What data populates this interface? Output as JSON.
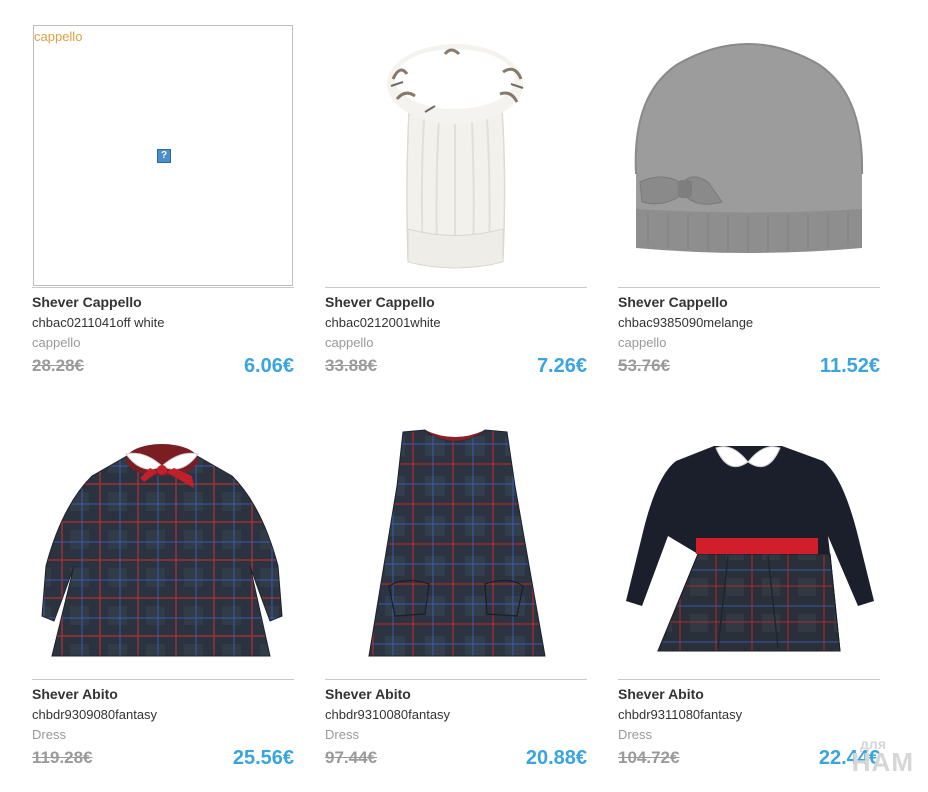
{
  "products": [
    {
      "brand": "Shever Cappello",
      "sku": "chbac0211041off white",
      "category": "cappello",
      "old_price": "28.28€",
      "new_price": "6.06€",
      "image": "broken",
      "alt": "cappello"
    },
    {
      "brand": "Shever Cappello",
      "sku": "chbac0212001white",
      "category": "cappello",
      "old_price": "33.88€",
      "new_price": "7.26€",
      "image": "white-pompom-hat"
    },
    {
      "brand": "Shever Cappello",
      "sku": "chbac9385090melange",
      "category": "cappello",
      "old_price": "53.76€",
      "new_price": "11.52€",
      "image": "grey-bow-beanie"
    },
    {
      "brand": "Shever Abito",
      "sku": "chbdr9309080fantasy",
      "category": "Dress",
      "old_price": "119.28€",
      "new_price": "25.56€",
      "image": "plaid-dress-collar"
    },
    {
      "brand": "Shever Abito",
      "sku": "chbdr9310080fantasy",
      "category": "Dress",
      "old_price": "97.44€",
      "new_price": "20.88€",
      "image": "plaid-pinafore-dress"
    },
    {
      "brand": "Shever Abito",
      "sku": "chbdr9311080fantasy",
      "category": "Dress",
      "old_price": "104.72€",
      "new_price": "22.44€",
      "image": "navy-dress-red-band"
    }
  ],
  "broken_image_glyph": "?",
  "watermark": {
    "line1": "для",
    "line2": "НАМ"
  },
  "colors": {
    "price_new": "#3aa4dd",
    "price_old": "#9a9a9a",
    "alt_text": "#e0a040"
  }
}
